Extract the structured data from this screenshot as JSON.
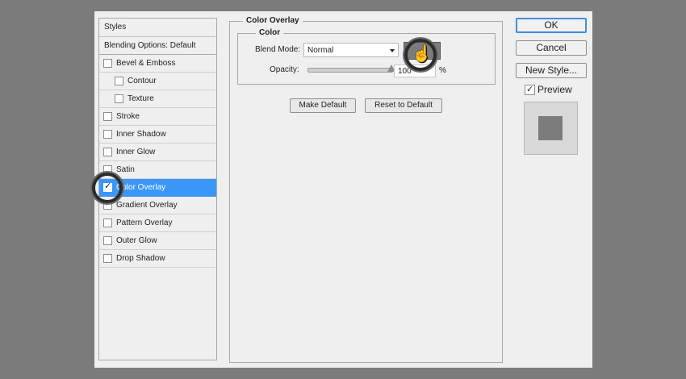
{
  "styles_panel": {
    "header": "Styles",
    "blending_options": "Blending Options: Default",
    "items": [
      {
        "label": "Bevel & Emboss",
        "checked": false,
        "sub": false
      },
      {
        "label": "Contour",
        "checked": false,
        "sub": true
      },
      {
        "label": "Texture",
        "checked": false,
        "sub": true
      },
      {
        "label": "Stroke",
        "checked": false,
        "sub": false
      },
      {
        "label": "Inner Shadow",
        "checked": false,
        "sub": false
      },
      {
        "label": "Inner Glow",
        "checked": false,
        "sub": false
      },
      {
        "label": "Satin",
        "checked": false,
        "sub": false
      },
      {
        "label": "Color Overlay",
        "checked": true,
        "sub": false,
        "selected": true
      },
      {
        "label": "Gradient Overlay",
        "checked": false,
        "sub": false
      },
      {
        "label": "Pattern Overlay",
        "checked": false,
        "sub": false
      },
      {
        "label": "Outer Glow",
        "checked": false,
        "sub": false
      },
      {
        "label": "Drop Shadow",
        "checked": false,
        "sub": false
      }
    ]
  },
  "color_overlay": {
    "section_title": "Color Overlay",
    "group_title": "Color",
    "blend_mode_label": "Blend Mode:",
    "blend_mode_value": "Normal",
    "overlay_color": "#7c7c7c",
    "opacity_label": "Opacity:",
    "opacity_value": "100",
    "opacity_unit": "%",
    "make_default": "Make Default",
    "reset_default": "Reset to Default"
  },
  "actions": {
    "ok": "OK",
    "cancel": "Cancel",
    "new_style": "New Style...",
    "preview_label": "Preview",
    "preview_checked": true
  },
  "colors": {
    "selection": "#3a97f9",
    "background": "#7b7b7b",
    "dialog": "#efefef"
  }
}
